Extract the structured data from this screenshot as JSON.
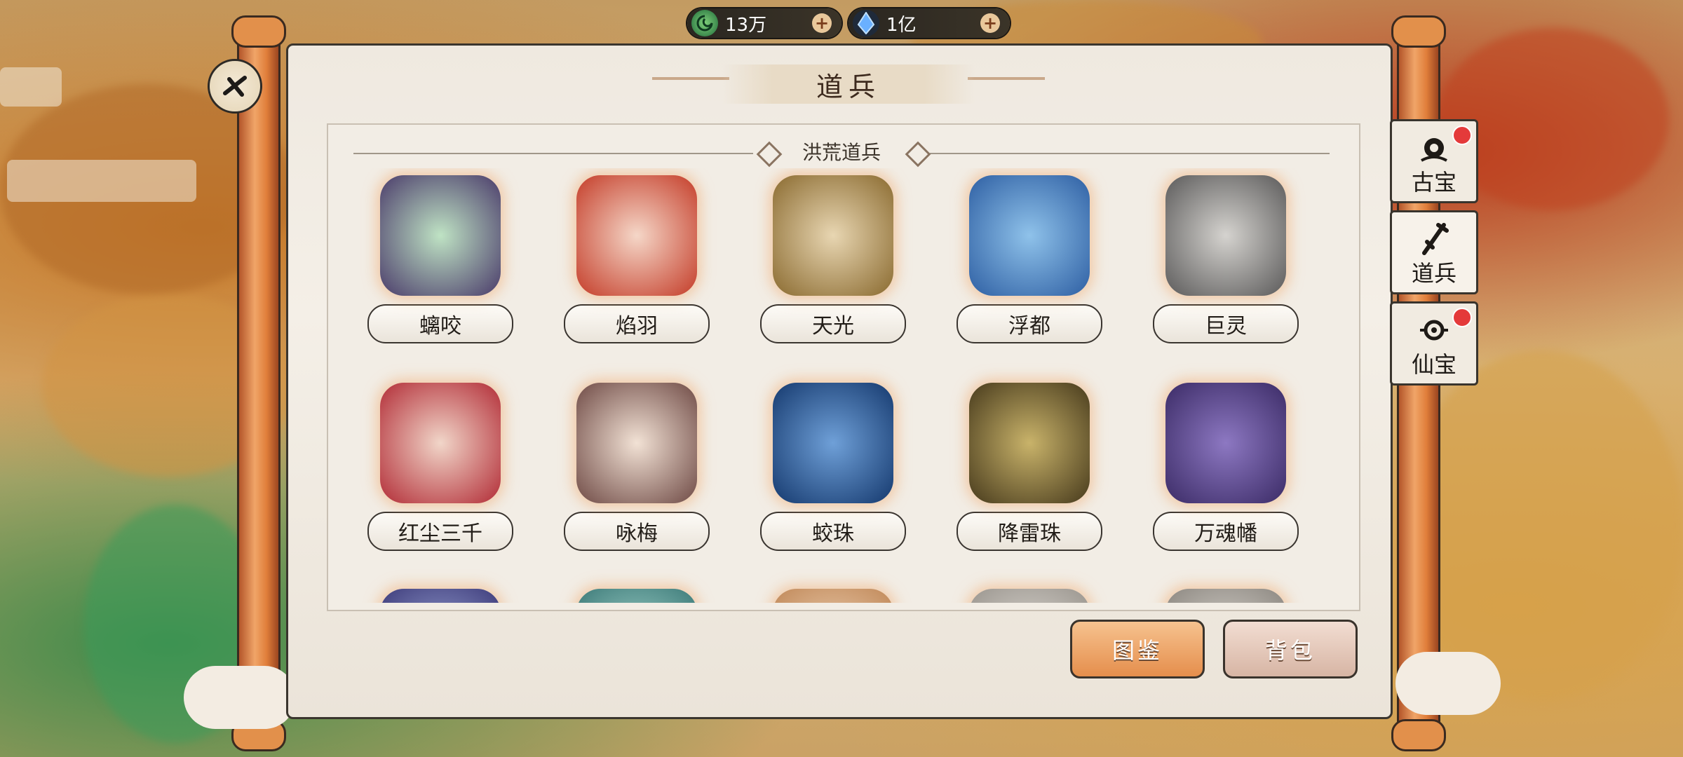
{
  "currency": [
    {
      "icon": "jade-coin-icon",
      "value": "13万"
    },
    {
      "icon": "spirit-crystal-icon",
      "value": "1亿"
    }
  ],
  "header": {
    "title": "道兵"
  },
  "section": {
    "title": "洪荒道兵"
  },
  "items": [
    {
      "name": "螭咬",
      "colors": [
        "#bfe3c4",
        "#4a3b6a"
      ]
    },
    {
      "name": "焰羽",
      "colors": [
        "#f5d7c8",
        "#c43c28"
      ]
    },
    {
      "name": "天光",
      "colors": [
        "#e8d6b2",
        "#8a6a2f"
      ]
    },
    {
      "name": "浮都",
      "colors": [
        "#8fc2ea",
        "#2e5fa3"
      ]
    },
    {
      "name": "巨灵",
      "colors": [
        "#d5d3cf",
        "#5b5a5a"
      ]
    },
    {
      "name": "红尘三千",
      "colors": [
        "#f1d6c9",
        "#b22c36"
      ]
    },
    {
      "name": "咏梅",
      "colors": [
        "#f2e2d5",
        "#6f4a45"
      ]
    },
    {
      "name": "蛟珠",
      "colors": [
        "#6fa0d8",
        "#15396e"
      ]
    },
    {
      "name": "降雷珠",
      "colors": [
        "#c9b36a",
        "#473a1c"
      ]
    },
    {
      "name": "万魂幡",
      "colors": [
        "#8d78c2",
        "#3b2b66"
      ]
    }
  ],
  "buttons": {
    "codex": "图鉴",
    "bag": "背包"
  },
  "tabs": [
    {
      "label": "古宝",
      "icon": "ancient-treasure-icon",
      "alert": true
    },
    {
      "label": "道兵",
      "icon": "weapon-icon",
      "alert": false
    },
    {
      "label": "仙宝",
      "icon": "immortal-treasure-icon",
      "alert": true
    }
  ]
}
